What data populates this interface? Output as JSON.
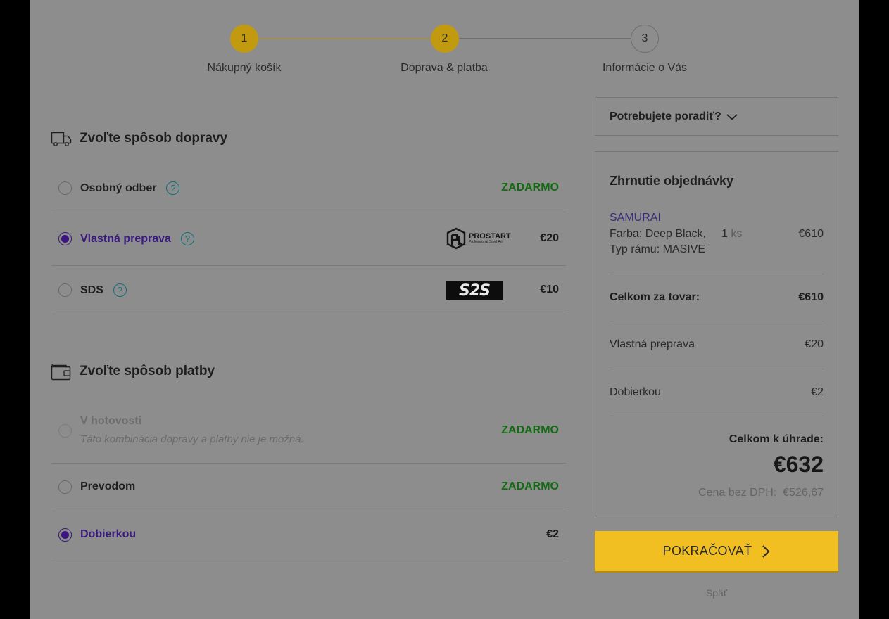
{
  "stepper": {
    "steps": [
      {
        "number": "1",
        "label": "Nákupný košík",
        "state": "done"
      },
      {
        "number": "2",
        "label": "Doprava & platba",
        "state": "current"
      },
      {
        "number": "3",
        "label": "Informácie o Vás",
        "state": "todo"
      }
    ]
  },
  "shipping": {
    "title": "Zvoľte spôsob dopravy",
    "options": [
      {
        "label": "Osobný odber",
        "help": "?",
        "price": "ZADARMO",
        "selected": false
      },
      {
        "label": "Vlastná preprava",
        "help": "?",
        "price": "€20",
        "selected": true,
        "logo_text": "PROSTART",
        "logo_sub": "Professional Steel Art"
      },
      {
        "label": "SDS",
        "help": "?",
        "price": "€10",
        "selected": false,
        "logo_text": "S2S"
      }
    ]
  },
  "payment": {
    "title": "Zvoľte spôsob platby",
    "options": [
      {
        "label": "V hotovosti",
        "note": "Táto kombinácia dopravy a platby nie je možná.",
        "price": "ZADARMO",
        "disabled": true
      },
      {
        "label": "Prevodom",
        "price": "ZADARMO",
        "selected": false
      },
      {
        "label": "Dobierkou",
        "price": "€2",
        "selected": true
      }
    ]
  },
  "help_box": {
    "label": "Potrebujete poradiť?"
  },
  "summary": {
    "title": "Zhrnutie objednávky",
    "item": {
      "name": "SAMURAI",
      "attr1": "Farba: Deep Black,",
      "attr2": "Typ rámu: MASIVE",
      "qty": "1",
      "qty_unit": "ks",
      "price": "€610"
    },
    "goods_label": "Celkom za tovar:",
    "goods_value": "€610",
    "shipping_label": "Vlastná preprava",
    "shipping_value": "€20",
    "payment_label": "Dobierkou",
    "payment_value": "€2",
    "total_label": "Celkom k úhrade:",
    "total_value": "€632",
    "net_label": "Cena bez DPH:",
    "net_value": "€526,67"
  },
  "continue_button": "POKRAČOVAŤ",
  "back_link": "Späť",
  "colors": {
    "accent": "#f2bf23",
    "step_done": "#c29a10",
    "selected": "#3b1680",
    "free": "#106b10",
    "help": "#0f6f7a"
  }
}
